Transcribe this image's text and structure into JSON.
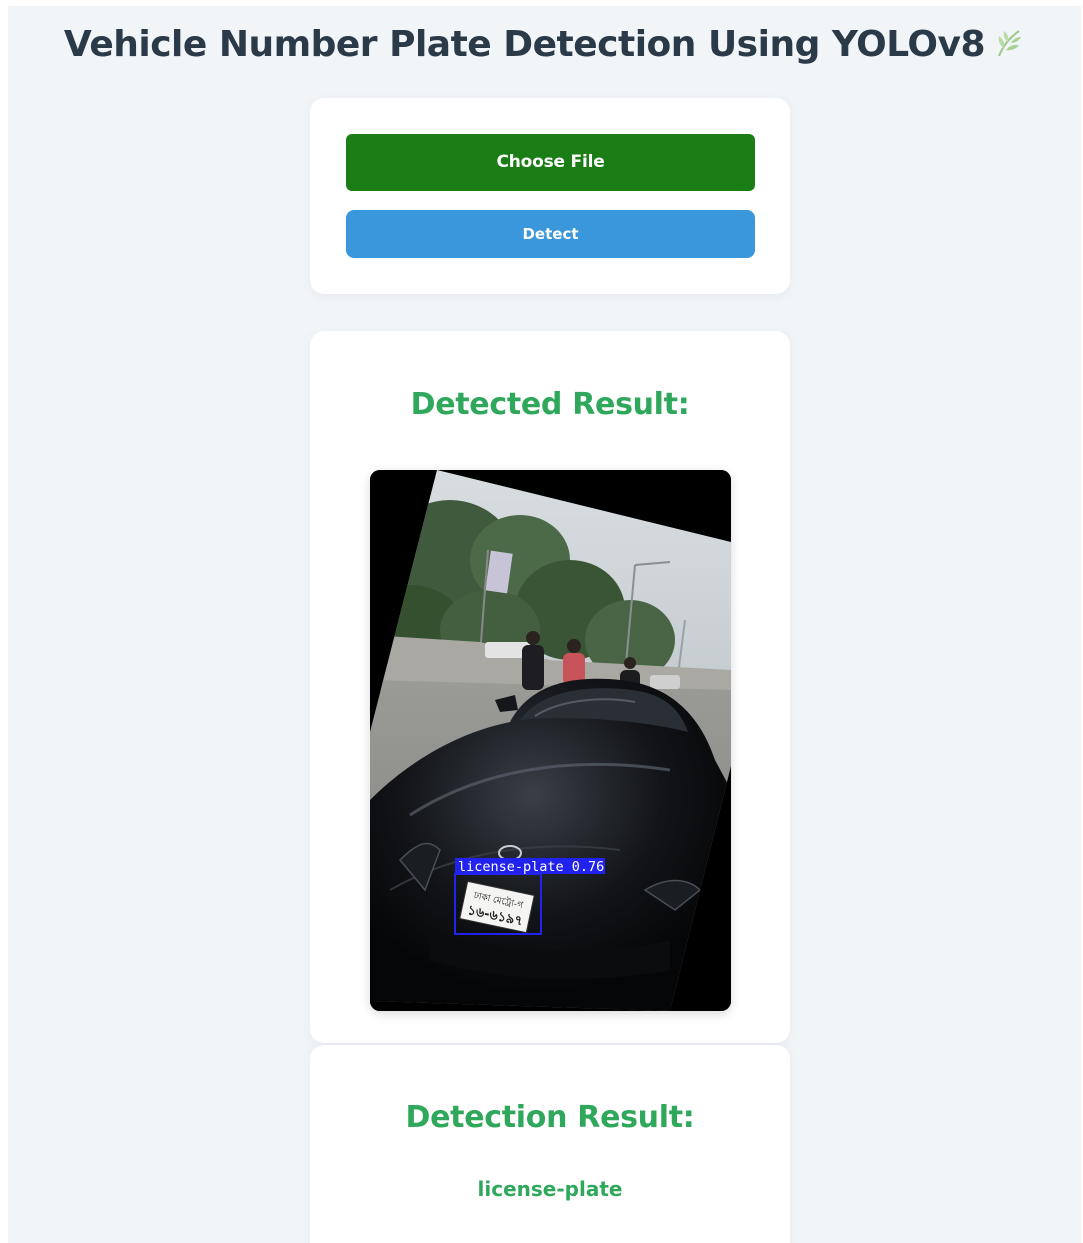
{
  "header": {
    "title": "Vehicle Number Plate Detection Using YOLOv8",
    "icon": "leaf-icon"
  },
  "upload": {
    "choose_label": "Choose File",
    "detect_label": "Detect",
    "colors": {
      "choose": "#1a7d15",
      "detect": "#3a97dc"
    }
  },
  "result": {
    "heading": "Detected Result:",
    "bbox_label": "license-plate 0.76",
    "plate_line1": "ঢাকা মেট্রো-গ",
    "plate_line2": "১৬-৬১৯৭"
  },
  "detection": {
    "heading": "Detection Result:",
    "value": "license-plate",
    "accent": "#2fa85c"
  }
}
